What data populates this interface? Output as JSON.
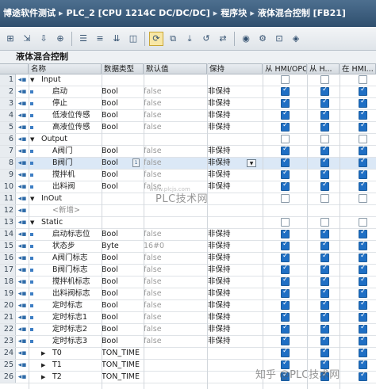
{
  "breadcrumb": [
    "博途软件测试",
    "PLC_2 [CPU 1214C DC/DC/DC]",
    "程序块",
    "液体混合控制 [FB21]"
  ],
  "breadcrumb_separator": "▸",
  "toolbar_icons": [
    "add-block-icon",
    "insert-row-icon",
    "download-icon",
    "insert-icon",
    "list-icon",
    "list2-icon",
    "expand-icon",
    "snapshot-icon",
    "active-mode-icon",
    "copy-values-icon",
    "load-values-icon",
    "restore-icon",
    "sync-icon",
    "monitor-icon",
    "settings-icon",
    "retain-icon",
    "init-icon"
  ],
  "block_title": "液体混合控制",
  "columns": {
    "name": "名称",
    "datatype": "数据类型",
    "default": "默认值",
    "retain": "保持",
    "hmi1": "从 HMI/OPC...",
    "hmi2": "从 H...",
    "hmi3": "在 HMI..."
  },
  "rows": [
    {
      "num": "1",
      "level": 0,
      "expand": "▼",
      "name": "Input",
      "dtype": "",
      "def": "",
      "retain": "",
      "cb": [
        false,
        false,
        false
      ]
    },
    {
      "num": "2",
      "level": 1,
      "name": "启动",
      "dtype": "Bool",
      "def": "false",
      "retain": "非保持",
      "cb": [
        true,
        true,
        true
      ]
    },
    {
      "num": "3",
      "level": 1,
      "name": "停止",
      "dtype": "Bool",
      "def": "false",
      "retain": "非保持",
      "cb": [
        true,
        true,
        true
      ]
    },
    {
      "num": "4",
      "level": 1,
      "name": "低液位传感",
      "dtype": "Bool",
      "def": "false",
      "retain": "非保持",
      "cb": [
        true,
        true,
        true
      ]
    },
    {
      "num": "5",
      "level": 1,
      "name": "高液位传感",
      "dtype": "Bool",
      "def": "false",
      "retain": "非保持",
      "cb": [
        true,
        true,
        true
      ]
    },
    {
      "num": "6",
      "level": 0,
      "expand": "▼",
      "name": "Output",
      "dtype": "",
      "def": "",
      "retain": "",
      "cb": [
        false,
        false,
        false
      ]
    },
    {
      "num": "7",
      "level": 1,
      "name": "A阀门",
      "dtype": "Bool",
      "def": "false",
      "retain": "非保持",
      "cb": [
        true,
        true,
        true
      ]
    },
    {
      "num": "8",
      "level": 1,
      "name": "B阀门",
      "dtype": "Bool",
      "def": "false",
      "retain": "非保持",
      "cb": [
        true,
        true,
        true
      ],
      "selected": true
    },
    {
      "num": "9",
      "level": 1,
      "name": "搅拌机",
      "dtype": "Bool",
      "def": "false",
      "retain": "非保持",
      "cb": [
        true,
        true,
        true
      ]
    },
    {
      "num": "10",
      "level": 1,
      "name": "出料阀",
      "dtype": "Bool",
      "def": "false",
      "retain": "非保持",
      "cb": [
        true,
        true,
        true
      ]
    },
    {
      "num": "11",
      "level": 0,
      "expand": "▼",
      "name": "InOut",
      "dtype": "",
      "def": "",
      "retain": "",
      "cb": [
        false,
        false,
        false
      ]
    },
    {
      "num": "12",
      "level": 1,
      "name": "<新增>",
      "dtype": "",
      "def": "",
      "retain": "",
      "newadd": true,
      "cb": []
    },
    {
      "num": "13",
      "level": 0,
      "expand": "▼",
      "name": "Static",
      "dtype": "",
      "def": "",
      "retain": "",
      "cb": [
        false,
        false,
        false
      ]
    },
    {
      "num": "14",
      "level": 1,
      "name": "启动标志位",
      "dtype": "Bool",
      "def": "false",
      "retain": "非保持",
      "cb": [
        true,
        true,
        true
      ]
    },
    {
      "num": "15",
      "level": 1,
      "name": "状态步",
      "dtype": "Byte",
      "def": "16#0",
      "retain": "非保持",
      "cb": [
        true,
        true,
        true
      ]
    },
    {
      "num": "16",
      "level": 1,
      "name": "A阀门标志",
      "dtype": "Bool",
      "def": "false",
      "retain": "非保持",
      "cb": [
        true,
        true,
        true
      ]
    },
    {
      "num": "17",
      "level": 1,
      "name": "B阀门标志",
      "dtype": "Bool",
      "def": "false",
      "retain": "非保持",
      "cb": [
        true,
        true,
        true
      ]
    },
    {
      "num": "18",
      "level": 1,
      "name": "搅拌机标志",
      "dtype": "Bool",
      "def": "false",
      "retain": "非保持",
      "cb": [
        true,
        true,
        true
      ]
    },
    {
      "num": "19",
      "level": 1,
      "name": "出料阀标志",
      "dtype": "Bool",
      "def": "false",
      "retain": "非保持",
      "cb": [
        true,
        true,
        true
      ]
    },
    {
      "num": "20",
      "level": 1,
      "name": "定时标志",
      "dtype": "Bool",
      "def": "false",
      "retain": "非保持",
      "cb": [
        true,
        true,
        true
      ]
    },
    {
      "num": "21",
      "level": 1,
      "name": "定时标志1",
      "dtype": "Bool",
      "def": "false",
      "retain": "非保持",
      "cb": [
        true,
        true,
        true
      ]
    },
    {
      "num": "22",
      "level": 1,
      "name": "定时标志2",
      "dtype": "Bool",
      "def": "false",
      "retain": "非保持",
      "cb": [
        true,
        true,
        true
      ]
    },
    {
      "num": "23",
      "level": 1,
      "name": "定时标志3",
      "dtype": "Bool",
      "def": "false",
      "retain": "非保持",
      "cb": [
        true,
        true,
        true
      ]
    },
    {
      "num": "24",
      "level": 1,
      "expand": "▶",
      "name": "T0",
      "dtype": "TON_TIME",
      "def": "",
      "retain": "",
      "cb": [
        true,
        true,
        true
      ]
    },
    {
      "num": "25",
      "level": 1,
      "expand": "▶",
      "name": "T1",
      "dtype": "TON_TIME",
      "def": "",
      "retain": "",
      "cb": [
        true,
        true,
        true
      ]
    },
    {
      "num": "26",
      "level": 1,
      "expand": "▶",
      "name": "T2",
      "dtype": "TON_TIME",
      "def": "",
      "retain": "",
      "cb": [
        true,
        true,
        true
      ]
    }
  ],
  "selected_row_picker": "1",
  "watermark": "PLC技术网",
  "watermark_url": "www.plcjs.com",
  "footer_watermark": "知乎 @PLC技术网",
  "colors": {
    "title_bg": "#3a5b7c",
    "checkbox_on": "#1f6fc4",
    "selected_row": "#dbe8f6"
  }
}
